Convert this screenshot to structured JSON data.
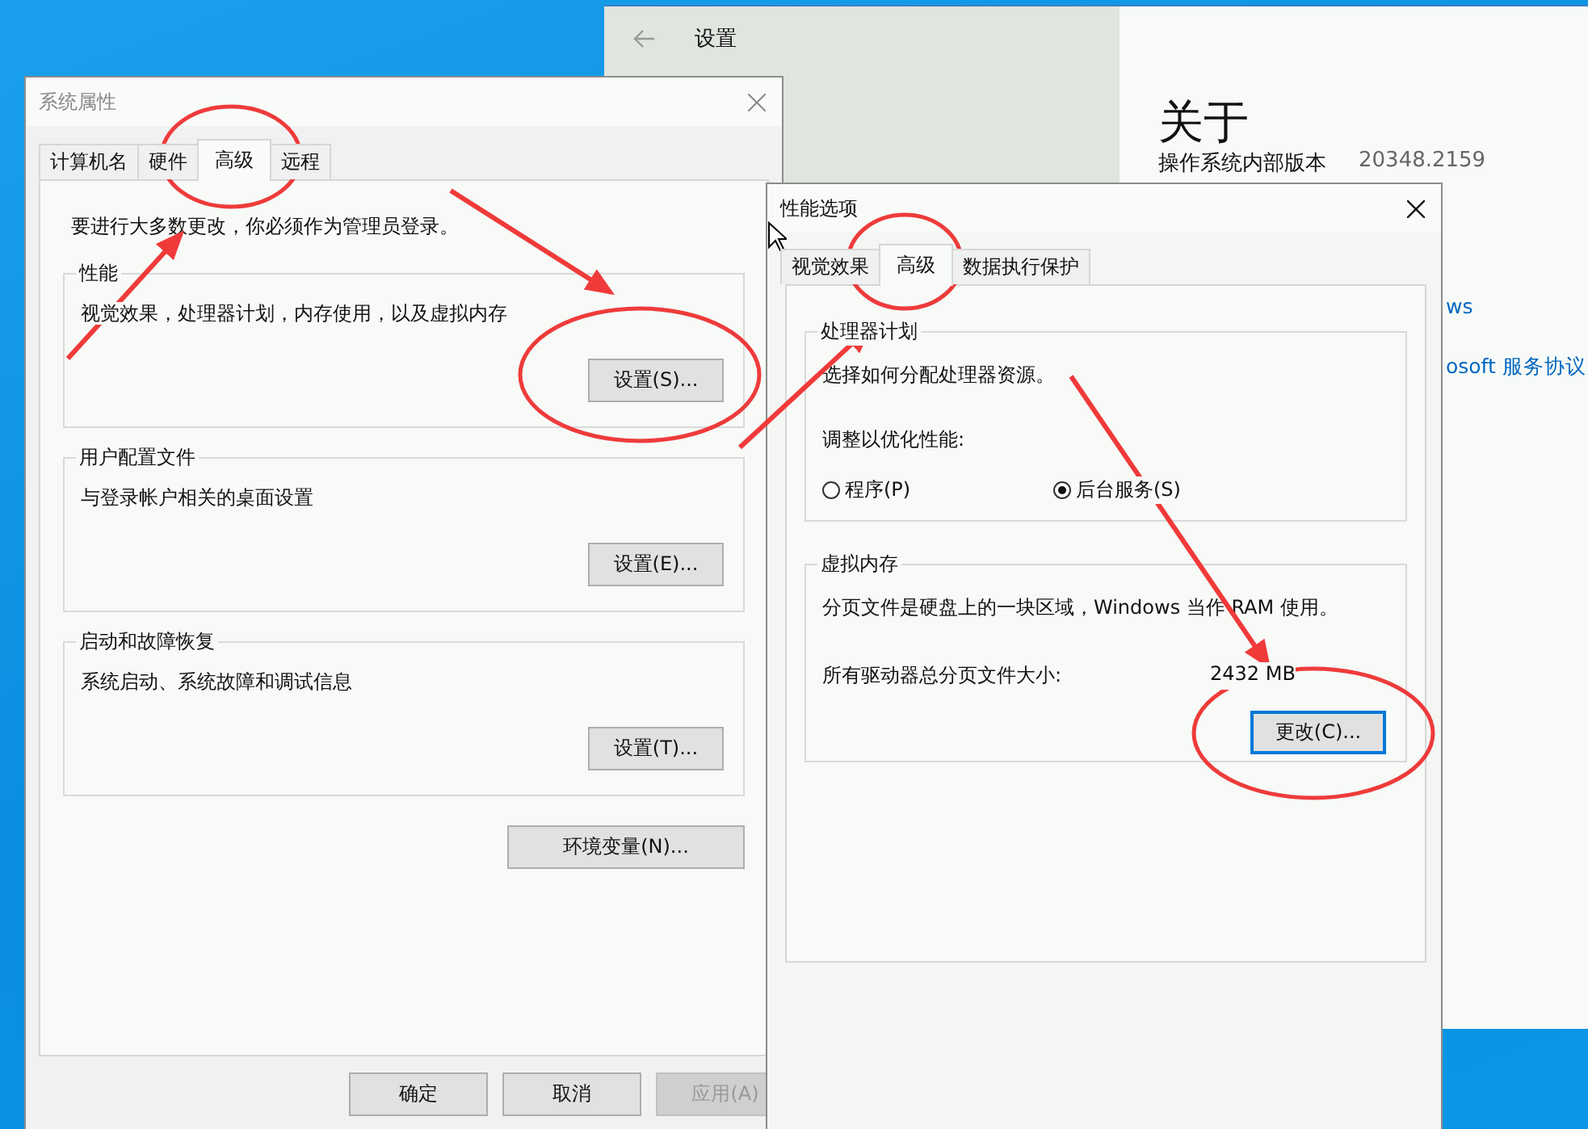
{
  "settings_window": {
    "title": "设置",
    "heading": "关于",
    "build_label": "操作系统内部版本",
    "build_value": "20348.2159",
    "links": [
      "ws",
      "osoft 服务协议"
    ]
  },
  "system_properties": {
    "title": "系统属性",
    "tabs": [
      {
        "label": "计算机名",
        "selected": false
      },
      {
        "label": "硬件",
        "selected": false
      },
      {
        "label": "高级",
        "selected": true
      },
      {
        "label": "远程",
        "selected": false
      }
    ],
    "notice": "要进行大多数更改，你必须作为管理员登录。",
    "groups": [
      {
        "title": "性能",
        "description": "视觉效果，处理器计划，内存使用，以及虚拟内存",
        "button": "设置(S)..."
      },
      {
        "title": "用户配置文件",
        "description": "与登录帐户相关的桌面设置",
        "button": "设置(E)..."
      },
      {
        "title": "启动和故障恢复",
        "description": "系统启动、系统故障和调试信息",
        "button": "设置(T)..."
      }
    ],
    "env_button": "环境变量(N)...",
    "buttons": [
      {
        "label": "确定",
        "disabled": false
      },
      {
        "label": "取消",
        "disabled": false
      },
      {
        "label": "应用(A)",
        "disabled": true
      }
    ]
  },
  "performance_options": {
    "title": "性能选项",
    "tabs": [
      {
        "label": "视觉效果",
        "selected": false
      },
      {
        "label": "高级",
        "selected": true
      },
      {
        "label": "数据执行保护",
        "selected": false
      }
    ],
    "processor_group": {
      "title": "处理器计划",
      "description": "选择如何分配处理器资源。",
      "prompt": "调整以优化性能:",
      "options": [
        {
          "label": "程序(P)",
          "selected": false
        },
        {
          "label": "后台服务(S)",
          "selected": true
        }
      ]
    },
    "memory_group": {
      "title": "虚拟内存",
      "description": "分页文件是硬盘上的一块区域，Windows 当作 RAM 使用。",
      "size_label": "所有驱动器总分页文件大小:",
      "size_value": "2432 MB",
      "button": {
        "label": "更改(C)...",
        "focused": true
      }
    }
  }
}
